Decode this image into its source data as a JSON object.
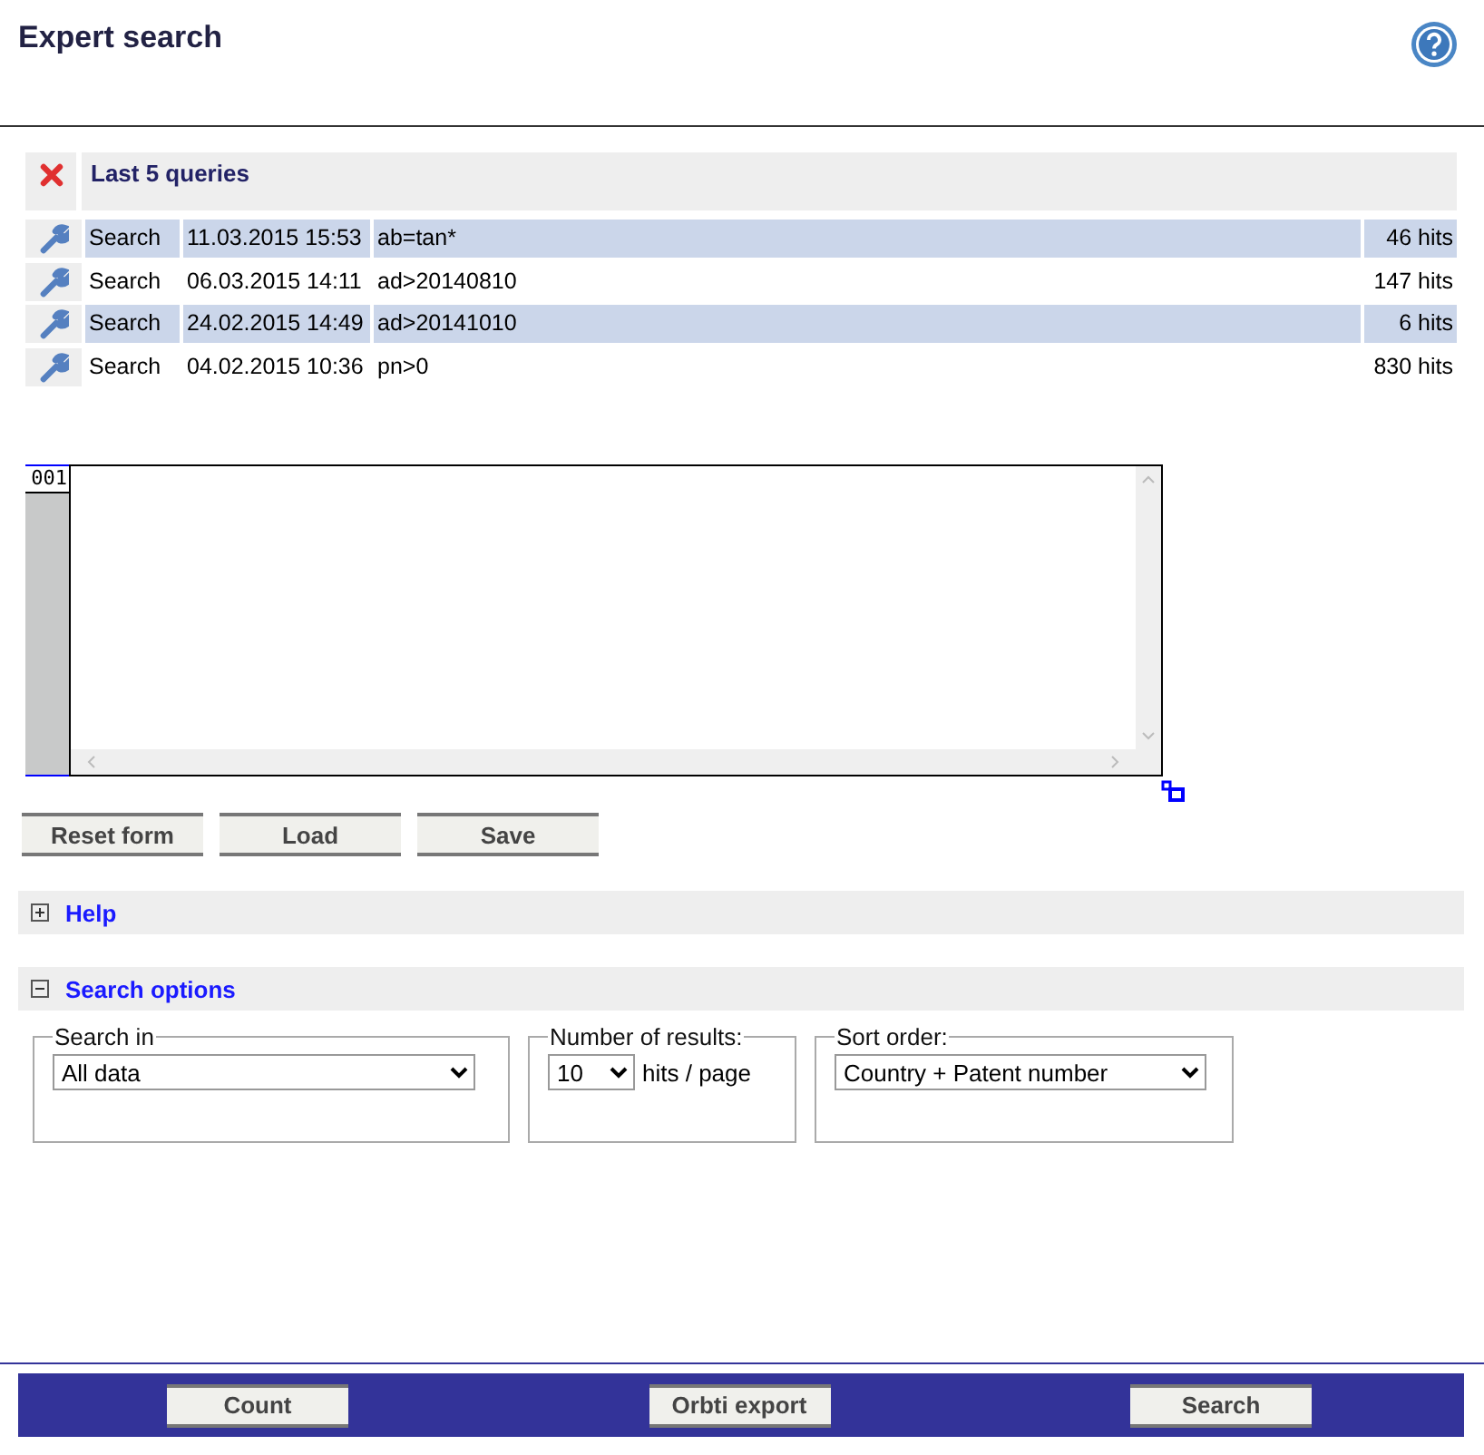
{
  "header": {
    "title": "Expert search"
  },
  "history": {
    "title": "Last 5 queries",
    "rows": [
      {
        "type": "Search",
        "date": "11.03.2015 15:53",
        "query": "ab=tan*",
        "hits": "46 hits"
      },
      {
        "type": "Search",
        "date": "06.03.2015 14:11",
        "query": "ad>20140810",
        "hits": "147 hits"
      },
      {
        "type": "Search",
        "date": "24.02.2015 14:49",
        "query": "ad>20141010",
        "hits": "6 hits"
      },
      {
        "type": "Search",
        "date": "04.02.2015 10:36",
        "query": "pn>0",
        "hits": "830 hits"
      }
    ]
  },
  "editor": {
    "line_number": "001"
  },
  "form_buttons": [
    "Reset form",
    "Load",
    "Save"
  ],
  "sections": [
    {
      "title": "Help",
      "expanded": false
    },
    {
      "title": "Search options",
      "expanded": true
    }
  ],
  "options": [
    {
      "legend": "Search in",
      "value": "All data"
    },
    {
      "legend": "Number of results:",
      "value": "10",
      "suffix": "hits / page"
    },
    {
      "legend": "Sort order:",
      "value": "Country + Patent number"
    }
  ],
  "footer_buttons": [
    "Count",
    "Orbti export",
    "Search"
  ]
}
